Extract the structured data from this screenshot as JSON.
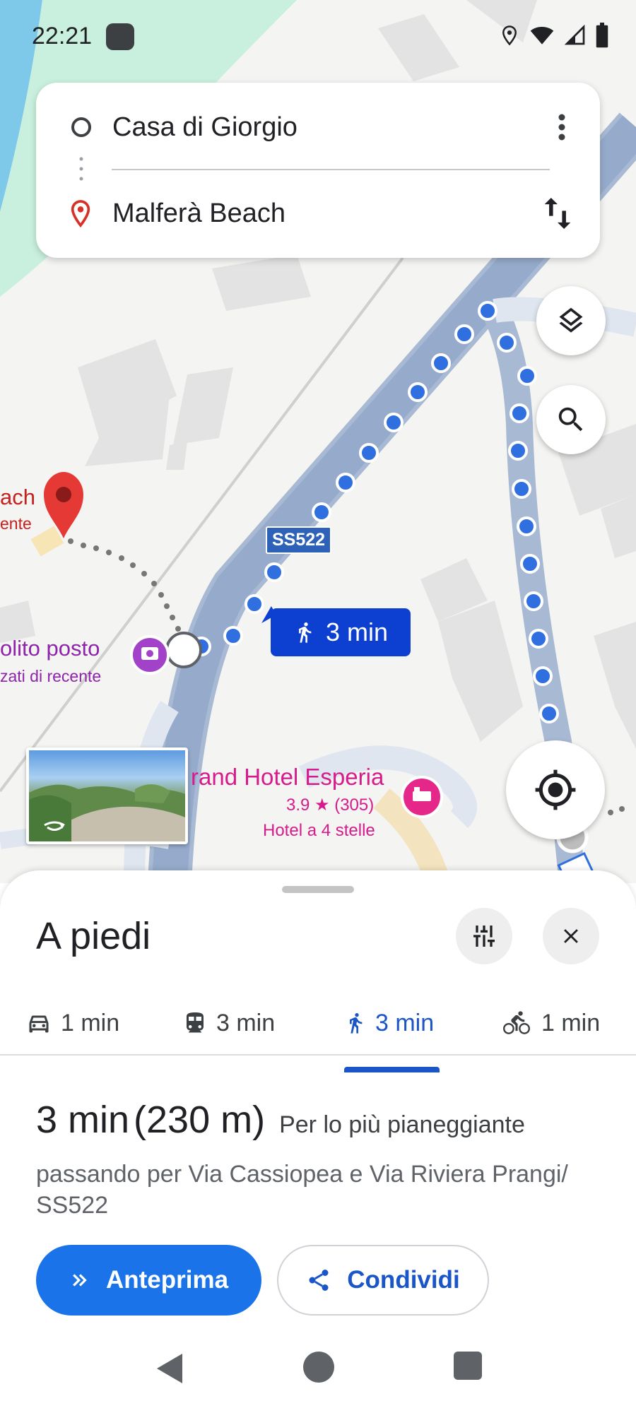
{
  "status_bar": {
    "time": "22:21",
    "icons": [
      "app-notification-icon",
      "location-icon",
      "wifi-icon",
      "signal-icon",
      "battery-icon"
    ]
  },
  "route": {
    "origin": "Casa di Giorgio",
    "destination": "Malferà Beach",
    "more_icon": "more-vert-icon",
    "swap_icon": "swap-vert-icon"
  },
  "map": {
    "labels": {
      "beach_name_partial": "ach",
      "beach_sub_partial": "ente",
      "photo_place_partial": "olito posto",
      "photo_place_sub_partial": "zati di recente",
      "hotel_name_partial": "rand Hotel Esperia",
      "hotel_rating": "3.9 ★ (305)",
      "hotel_type": "Hotel a 4 stelle",
      "road_shield": "SS522"
    },
    "eta_chip": "3 min",
    "buttons": [
      "layers-icon",
      "search-icon",
      "my-location-icon"
    ]
  },
  "sheet": {
    "title": "A piedi",
    "modes": [
      {
        "icon": "car-icon",
        "label": "1 min",
        "active": false
      },
      {
        "icon": "transit-icon",
        "label": "3 min",
        "active": false
      },
      {
        "icon": "walk-icon",
        "label": "3 min",
        "active": true
      },
      {
        "icon": "bike-icon",
        "label": "1 min",
        "active": false
      }
    ],
    "summary": {
      "duration": "3 min",
      "distance": "(230 m)",
      "qualifier": "Per lo più pianeggiante"
    },
    "via": "passando per Via Cassiopea e Via Riviera Prangi/ SS522",
    "buttons": {
      "preview": "Anteprima",
      "share": "Condividi"
    }
  },
  "colors": {
    "accent": "#1a73e8",
    "route_dots": "#2f6fe0",
    "chip": "#0d3fd1",
    "place_red": "#c5221f",
    "place_purple": "#8e24aa",
    "place_pink": "#d81b8c"
  }
}
